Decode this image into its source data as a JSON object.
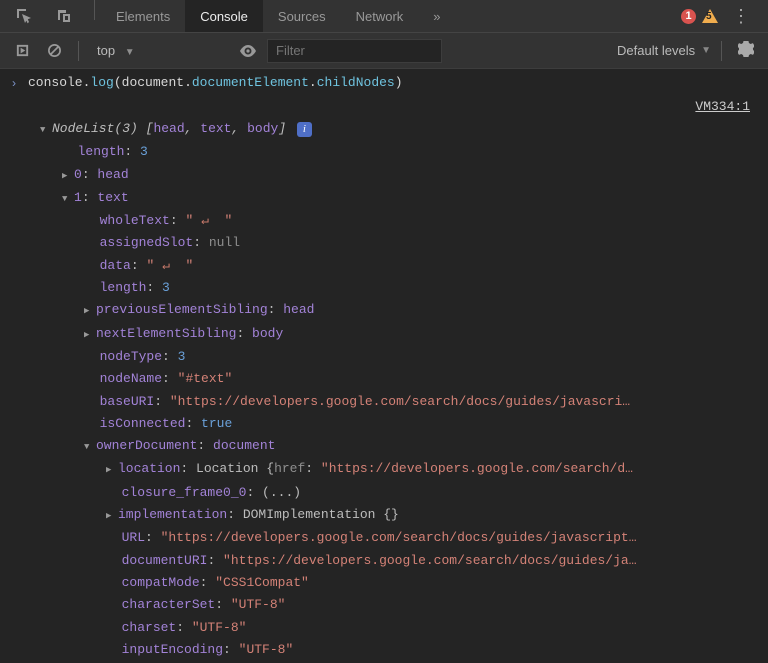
{
  "tabs": {
    "elements": "Elements",
    "console": "Console",
    "sources": "Sources",
    "network": "Network",
    "more": "»"
  },
  "status": {
    "error_count": "1",
    "warn_count": "5"
  },
  "toolbar": {
    "context": "top",
    "filter_placeholder": "Filter",
    "levels_label": "Default levels"
  },
  "cmd": {
    "p1": "console",
    "p2": ".",
    "p3": "log",
    "p4": "(",
    "p5": "document",
    "p6": ".",
    "p7": "documentElement",
    "p8": ".",
    "p9": "childNodes",
    "p10": ")"
  },
  "source_ref": "VM334:1",
  "tree": {
    "nodelist_label": "NodeList(3)",
    "nodelist_preview_open": " [",
    "nodelist_preview_items": [
      "head",
      "text",
      "body"
    ],
    "nodelist_preview_close": "]",
    "length_key": "length",
    "length_val": "3",
    "idx0_key": "0",
    "idx0_val": "head",
    "idx1_key": "1",
    "idx1_val": "text",
    "wholeText_key": "wholeText",
    "wholeText_q1": "\"",
    "wholeText_mid": " ",
    "wholeText_enter": "↵",
    "wholeText_tail": "  \"",
    "assignedSlot_key": "assignedSlot",
    "assignedSlot_val": "null",
    "data_key": "data",
    "length2_key": "length",
    "length2_val": "3",
    "prevSib_key": "previousElementSibling",
    "prevSib_val": "head",
    "nextSib_key": "nextElementSibling",
    "nextSib_val": "body",
    "nodeType_key": "nodeType",
    "nodeType_val": "3",
    "nodeName_key": "nodeName",
    "nodeName_val": "\"#text\"",
    "baseURI_key": "baseURI",
    "baseURI_val": "\"https://developers.google.com/search/docs/guides/javascri…",
    "isConnected_key": "isConnected",
    "isConnected_val": "true",
    "ownerDoc_key": "ownerDocument",
    "ownerDoc_val": "document",
    "location_key": "location",
    "location_type": "Location ",
    "location_brace": "{",
    "location_href_key": "href",
    "location_colon": ": ",
    "location_href_val": "\"https://developers.google.com/search/d…",
    "closure_key": "closure_frame0_0",
    "closure_val": "(...)",
    "impl_key": "implementation",
    "impl_val": "DOMImplementation {}",
    "url_key": "URL",
    "url_val": "\"https://developers.google.com/search/docs/guides/javascript…",
    "docURI_key": "documentURI",
    "docURI_val": "\"https://developers.google.com/search/docs/guides/ja…",
    "compat_key": "compatMode",
    "compat_val": "\"CSS1Compat\"",
    "charset_key": "characterSet",
    "charset_val": "\"UTF-8\"",
    "charset2_key": "charset",
    "charset2_val": "\"UTF-8\"",
    "inputEnc_key": "inputEncoding",
    "inputEnc_val": "\"UTF-8\""
  }
}
